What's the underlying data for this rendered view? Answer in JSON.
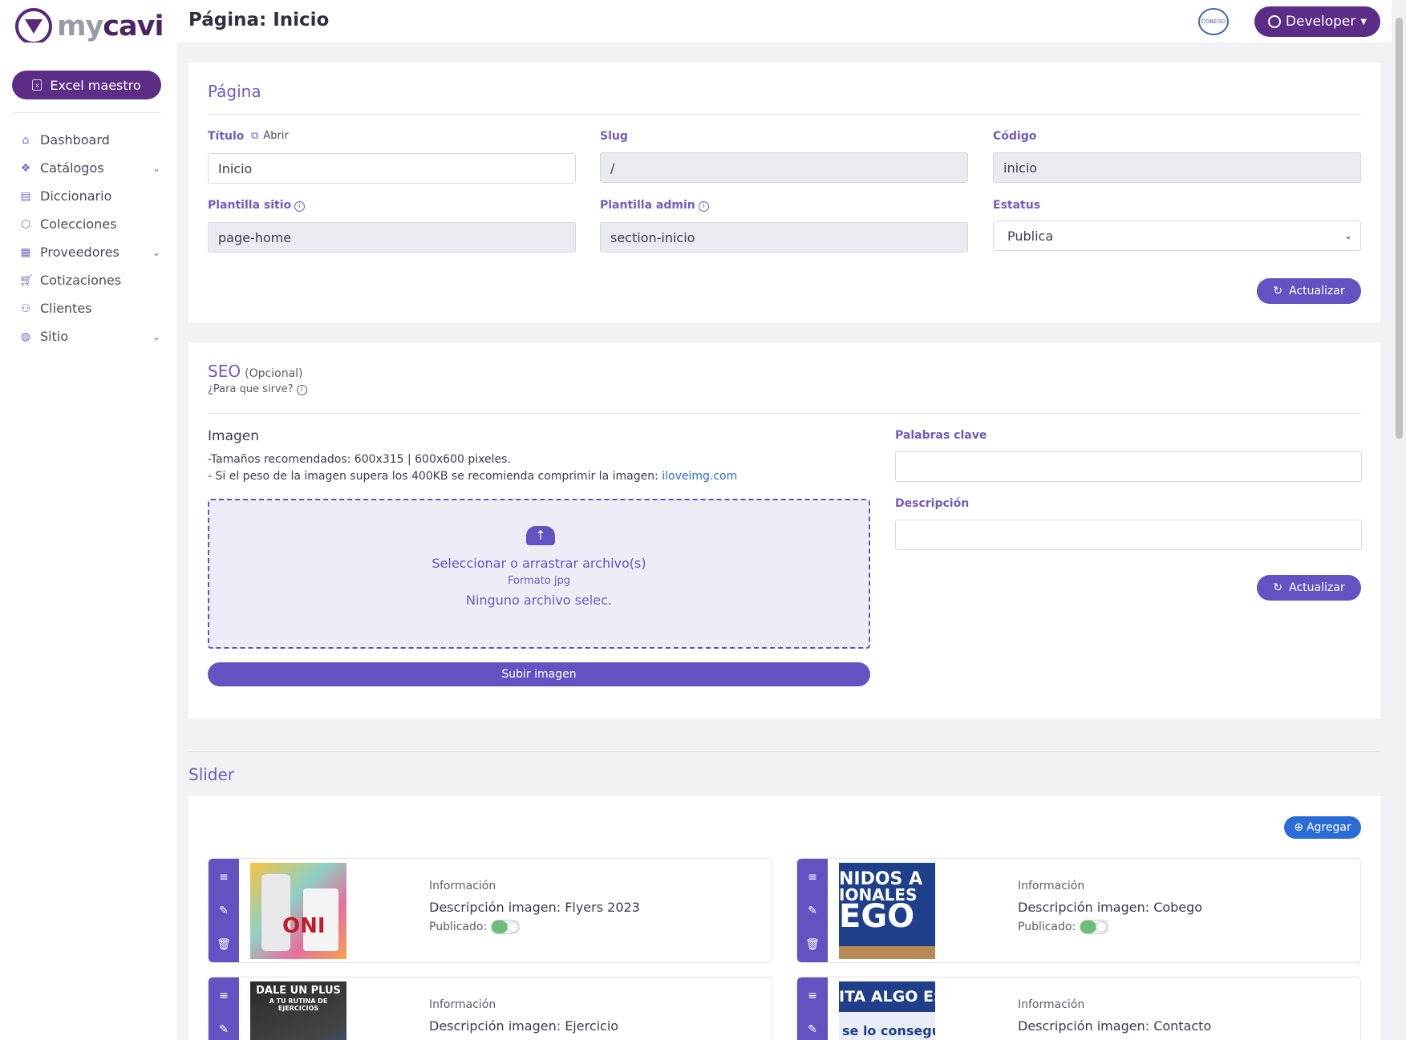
{
  "app": {
    "brand_my": "my",
    "brand_cavi": "cavi",
    "page_heading": "Página: Inicio"
  },
  "user": {
    "name": "Developer"
  },
  "partner_logo_text": "COBEGO",
  "sidebar": {
    "excel_button": "Excel maestro",
    "items": [
      {
        "label": "Dashboard",
        "icon": "home-icon"
      },
      {
        "label": "Catálogos",
        "icon": "boxes-icon",
        "expandable": true
      },
      {
        "label": "Diccionario",
        "icon": "book-icon"
      },
      {
        "label": "Colecciones",
        "icon": "cube-icon"
      },
      {
        "label": "Proveedores",
        "icon": "building-icon",
        "expandable": true
      },
      {
        "label": "Cotizaciones",
        "icon": "cart-icon"
      },
      {
        "label": "Clientes",
        "icon": "users-icon"
      },
      {
        "label": "Sitio",
        "icon": "globe-icon",
        "expandable": true
      }
    ]
  },
  "pagina": {
    "title": "Página",
    "titulo_label": "Título",
    "abrir_label": "Abrir",
    "titulo_value": "Inicio",
    "slug_label": "Slug",
    "slug_value": "/",
    "codigo_label": "Código",
    "codigo_value": "inicio",
    "plantilla_sitio_label": "Plantilla sitio",
    "plantilla_sitio_value": "page-home",
    "plantilla_admin_label": "Plantilla admin",
    "plantilla_admin_value": "section-inicio",
    "estatus_label": "Estatus",
    "estatus_value": "Publica",
    "update_button": "Actualizar"
  },
  "seo": {
    "title": "SEO",
    "optional": "(Opcional)",
    "help": "¿Para que sirve?",
    "imagen_label": "Imagen",
    "hint1": "-Tamaños recomendados: 600x315 | 600x600 pixeles.",
    "hint2_prefix": "- Si el peso de la imagen supera los 400KB se recomienda comprimir la imagen: ",
    "hint2_link": "iloveimg.com",
    "drop_title": "Seleccionar o arrastrar archivo(s)",
    "drop_format": "Formato jpg",
    "drop_status": "Ninguno archivo selec.",
    "upload_button": "Subir imagen",
    "keywords_label": "Palabras clave",
    "keywords_value": "",
    "description_label": "Descripción",
    "description_value": "",
    "update_button": "Actualizar"
  },
  "slider": {
    "title": "Slider",
    "add_button": "Agregar",
    "items": [
      {
        "info": "Información",
        "description": "Descripción imagen: Flyers 2023",
        "published_label": "Publicado:",
        "published": true
      },
      {
        "info": "Información",
        "description": "Descripción imagen: Cobego",
        "published_label": "Publicado:",
        "published": true
      },
      {
        "info": "Información",
        "description": "Descripción imagen: Ejercicio"
      },
      {
        "info": "Información",
        "description": "Descripción imagen: Contacto"
      }
    ],
    "thumb_texts": {
      "cobego_line1": "NIDOS A",
      "cobego_line2": "IONALES",
      "cobego_line3": "EGO",
      "ejercicio_line1": "DALE UN PLUS",
      "ejercicio_line2": "A TU RUTINA DE EJERCICIOS",
      "contacto_line1": "ITA ALGO ESP",
      "contacto_line2": "se lo conseguim"
    }
  },
  "colors": {
    "brand": "#5c2d86",
    "accent": "#6353c2",
    "heading": "#6f5bbf"
  }
}
